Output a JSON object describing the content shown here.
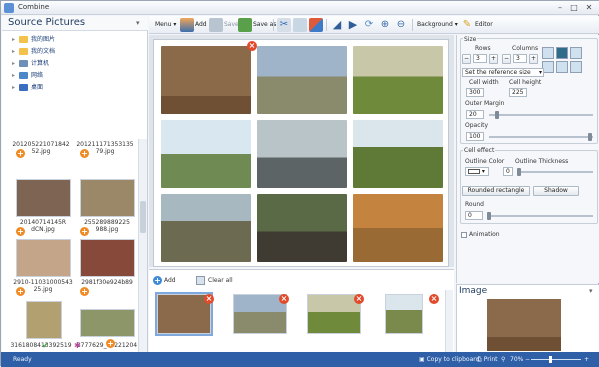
{
  "window": {
    "title": "Combine"
  },
  "left_panel": {
    "title": "Source Pictures",
    "tree": [
      {
        "label": "我的图片",
        "color": "#f2c24a"
      },
      {
        "label": "我的文档",
        "color": "#f2c24a"
      },
      {
        "label": "计算机",
        "color": "#6d8fb8"
      },
      {
        "label": "网络",
        "color": "#4c88c9"
      },
      {
        "label": "桌面",
        "color": "#3a6fbf"
      }
    ],
    "thumbnails": [
      {
        "name": "20120522107184252.jpg",
        "line1": "201205221071842",
        "line2": "52.jpg",
        "color": "#c8d4e2"
      },
      {
        "name": "20121117135313579.jpg",
        "line1": "201211171353135",
        "line2": "79.jpg",
        "color": "#b9c6d3"
      },
      {
        "name": "20140714145R_dCN.jpg",
        "line1": "20140714145R",
        "line2": "dCN.jpg",
        "color": "#8a6a56"
      },
      {
        "name": "2552898892254988.jpg",
        "line1": "255289889225",
        "line2": "988.jpg",
        "color": "#9c8a6a"
      },
      {
        "name": "2910-11031000543.jpg",
        "line1": "2910-11031000543",
        "line2": "25.jpg",
        "color": "#c9a88a"
      },
      {
        "name": "2981f30e9f24b89.jpg",
        "line1": "2981f30e924b89",
        "line2": "",
        "color": "#8a4a3a"
      },
      {
        "name": "3161808413392519.jpg",
        "line1": "3161808413392519",
        "line2": "",
        "color": "#b7a572"
      },
      {
        "name": "3777629_17221204.jpg",
        "line1": "3777629_17221204",
        "line2": "",
        "color": "#8f9a6a"
      }
    ]
  },
  "toolbar": {
    "menu_label": "Menu",
    "add_label": "Add",
    "save_label": "Save",
    "save_as_label": "Save as",
    "background_label": "Background",
    "editor_label": "Editor"
  },
  "collage": {
    "cells": [
      {
        "subject": "gazelle",
        "color": "#8b6a4a"
      },
      {
        "subject": "rhinos",
        "color": "#7a8aa0"
      },
      {
        "subject": "cheetah",
        "color": "#a89a6a"
      },
      {
        "subject": "giraffes",
        "color": "#6f8a52"
      },
      {
        "subject": "elephant",
        "color": "#6a7078"
      },
      {
        "subject": "giraffe",
        "color": "#7c8c4a"
      },
      {
        "subject": "elephants",
        "color": "#7d7a60"
      },
      {
        "subject": "antelope",
        "color": "#4d5a3e"
      },
      {
        "subject": "deer herd",
        "color": "#b0783a"
      }
    ]
  },
  "settings": {
    "size_title": "Size",
    "rows_label": "Rows",
    "rows_value": "3",
    "columns_label": "Columns",
    "columns_value": "3",
    "reference_size": "Set the reference size",
    "cell_width_label": "Cell width",
    "cell_width_value": "300",
    "cell_height_label": "Cell height",
    "cell_height_value": "225",
    "outer_margin_label": "Outer Margin",
    "outer_margin_value": "20",
    "opacity_label": "Opacity",
    "opacity_value": "100",
    "cell_effect_title": "Cell effect",
    "outline_color_label": "Outline Color",
    "outline_thickness_label": "Outline Thickness",
    "outline_thickness_value": "0",
    "rounded_button": "Rounded rectangle",
    "shadow_button": "Shadow",
    "round_label": "Round",
    "round_value": "0",
    "animation_label": "Animation"
  },
  "strip": {
    "add_label": "Add",
    "clear_label": "Clear all",
    "items": [
      {
        "color": "#8a6a4a"
      },
      {
        "color": "#7f8a98"
      },
      {
        "color": "#a99a68"
      },
      {
        "color": "#7a8a4c"
      }
    ]
  },
  "preview": {
    "title": "Image"
  },
  "status": {
    "ready": "Ready",
    "copy_clipboard": "Copy to clipboard",
    "print": "Print",
    "zoom": "70%"
  }
}
